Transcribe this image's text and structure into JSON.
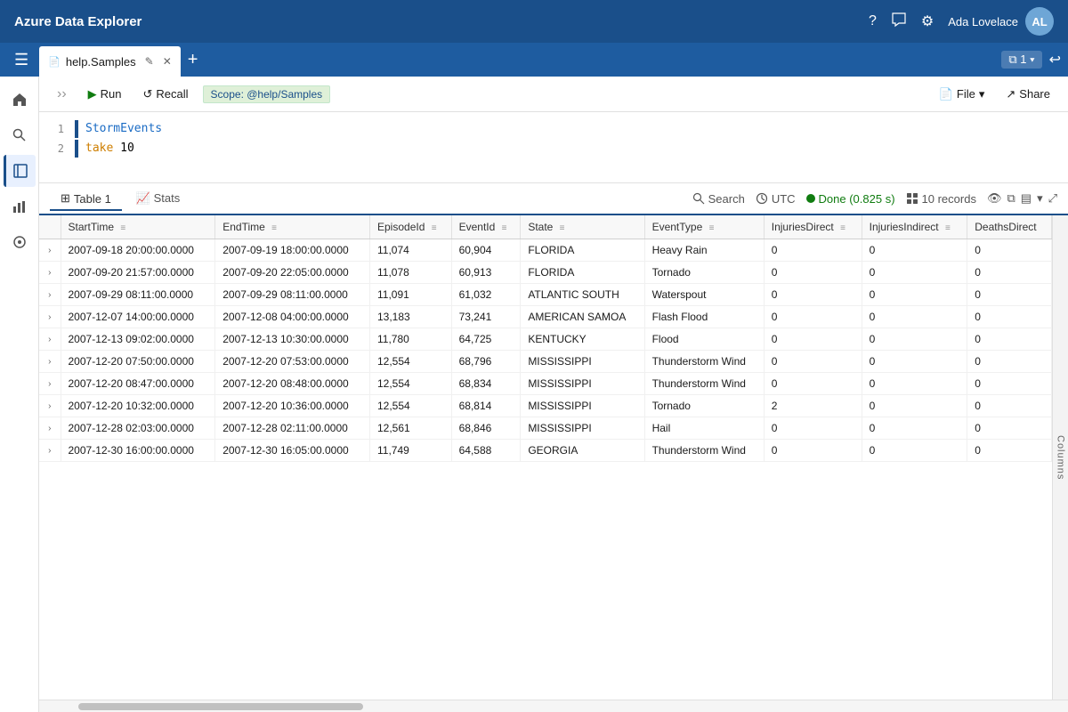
{
  "app": {
    "title": "Azure Data Explorer"
  },
  "topbar": {
    "title": "Azure Data Explorer",
    "user": "Ada Lovelace",
    "user_initials": "AL"
  },
  "tabbar": {
    "tab_label": "help.Samples",
    "window_count": "1",
    "add_label": "+"
  },
  "toolbar": {
    "run_label": "Run",
    "recall_label": "Recall",
    "scope_label": "Scope: @help/Samples",
    "file_label": "File",
    "share_label": "Share"
  },
  "editor": {
    "line1_text": "StormEvents",
    "line2_text": "take 10",
    "line2_keyword": "take",
    "line2_value": "10"
  },
  "results": {
    "tab1_icon": "⊞",
    "tab1_label": "Table 1",
    "tab2_label": "Stats",
    "search_label": "Search",
    "utc_label": "UTC",
    "done_label": "Done (0.825 s)",
    "records_label": "10 records",
    "columns_label": "Columns"
  },
  "table": {
    "columns": [
      {
        "key": "expand",
        "label": ""
      },
      {
        "key": "StartTime",
        "label": "StartTime"
      },
      {
        "key": "EndTime",
        "label": "EndTime"
      },
      {
        "key": "EpisodeId",
        "label": "EpisodeId"
      },
      {
        "key": "EventId",
        "label": "EventId"
      },
      {
        "key": "State",
        "label": "State"
      },
      {
        "key": "EventType",
        "label": "EventType"
      },
      {
        "key": "InjuriesDirect",
        "label": "InjuriesDirect"
      },
      {
        "key": "InjuriesIndirect",
        "label": "InjuriesIndirect"
      },
      {
        "key": "DeathsDirect",
        "label": "DeathsDirect"
      }
    ],
    "rows": [
      {
        "expand": "›",
        "StartTime": "2007-09-18 20:00:00.0000",
        "EndTime": "2007-09-19 18:00:00.0000",
        "EpisodeId": "11,074",
        "EventId": "60,904",
        "State": "FLORIDA",
        "EventType": "Heavy Rain",
        "InjuriesDirect": "0",
        "InjuriesIndirect": "0",
        "DeathsDirect": "0"
      },
      {
        "expand": "›",
        "StartTime": "2007-09-20 21:57:00.0000",
        "EndTime": "2007-09-20 22:05:00.0000",
        "EpisodeId": "11,078",
        "EventId": "60,913",
        "State": "FLORIDA",
        "EventType": "Tornado",
        "InjuriesDirect": "0",
        "InjuriesIndirect": "0",
        "DeathsDirect": "0"
      },
      {
        "expand": "›",
        "StartTime": "2007-09-29 08:11:00.0000",
        "EndTime": "2007-09-29 08:11:00.0000",
        "EpisodeId": "11,091",
        "EventId": "61,032",
        "State": "ATLANTIC SOUTH",
        "EventType": "Waterspout",
        "InjuriesDirect": "0",
        "InjuriesIndirect": "0",
        "DeathsDirect": "0"
      },
      {
        "expand": "›",
        "StartTime": "2007-12-07 14:00:00.0000",
        "EndTime": "2007-12-08 04:00:00.0000",
        "EpisodeId": "13,183",
        "EventId": "73,241",
        "State": "AMERICAN SAMOA",
        "EventType": "Flash Flood",
        "InjuriesDirect": "0",
        "InjuriesIndirect": "0",
        "DeathsDirect": "0"
      },
      {
        "expand": "›",
        "StartTime": "2007-12-13 09:02:00.0000",
        "EndTime": "2007-12-13 10:30:00.0000",
        "EpisodeId": "11,780",
        "EventId": "64,725",
        "State": "KENTUCKY",
        "EventType": "Flood",
        "InjuriesDirect": "0",
        "InjuriesIndirect": "0",
        "DeathsDirect": "0"
      },
      {
        "expand": "›",
        "StartTime": "2007-12-20 07:50:00.0000",
        "EndTime": "2007-12-20 07:53:00.0000",
        "EpisodeId": "12,554",
        "EventId": "68,796",
        "State": "MISSISSIPPI",
        "EventType": "Thunderstorm Wind",
        "InjuriesDirect": "0",
        "InjuriesIndirect": "0",
        "DeathsDirect": "0"
      },
      {
        "expand": "›",
        "StartTime": "2007-12-20 08:47:00.0000",
        "EndTime": "2007-12-20 08:48:00.0000",
        "EpisodeId": "12,554",
        "EventId": "68,834",
        "State": "MISSISSIPPI",
        "EventType": "Thunderstorm Wind",
        "InjuriesDirect": "0",
        "InjuriesIndirect": "0",
        "DeathsDirect": "0"
      },
      {
        "expand": "›",
        "StartTime": "2007-12-20 10:32:00.0000",
        "EndTime": "2007-12-20 10:36:00.0000",
        "EpisodeId": "12,554",
        "EventId": "68,814",
        "State": "MISSISSIPPI",
        "EventType": "Tornado",
        "InjuriesDirect": "2",
        "InjuriesIndirect": "0",
        "DeathsDirect": "0"
      },
      {
        "expand": "›",
        "StartTime": "2007-12-28 02:03:00.0000",
        "EndTime": "2007-12-28 02:11:00.0000",
        "EpisodeId": "12,561",
        "EventId": "68,846",
        "State": "MISSISSIPPI",
        "EventType": "Hail",
        "InjuriesDirect": "0",
        "InjuriesIndirect": "0",
        "DeathsDirect": "0"
      },
      {
        "expand": "›",
        "StartTime": "2007-12-30 16:00:00.0000",
        "EndTime": "2007-12-30 16:05:00.0000",
        "EpisodeId": "11,749",
        "EventId": "64,588",
        "State": "GEORGIA",
        "EventType": "Thunderstorm Wind",
        "InjuriesDirect": "0",
        "InjuriesIndirect": "0",
        "DeathsDirect": "0"
      }
    ]
  },
  "sidebar": {
    "items": [
      {
        "icon": "☰",
        "name": "menu"
      },
      {
        "icon": "⌂",
        "name": "home"
      },
      {
        "icon": "🔍",
        "name": "search"
      },
      {
        "icon": "◫",
        "name": "active-panel"
      },
      {
        "icon": "📊",
        "name": "charts"
      },
      {
        "icon": "◉",
        "name": "settings"
      }
    ]
  }
}
